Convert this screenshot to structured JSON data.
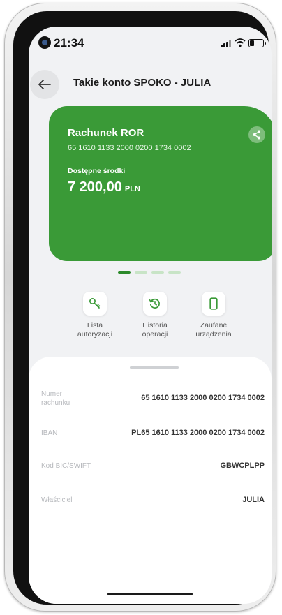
{
  "status_bar": {
    "time": "21:34"
  },
  "header": {
    "title": "Takie konto SPOKO - JULIA"
  },
  "account_card": {
    "name": "Rachunek ROR",
    "number": "65 1610 1133 2000 0200 1734 0002",
    "balance_label": "Dostępne środki",
    "balance_amount": "7 200,00",
    "currency": "PLN",
    "color": "#3a9a37"
  },
  "carousel": {
    "pages": 4,
    "active_index": 0
  },
  "actions": [
    {
      "icon": "key-icon",
      "line1": "Lista",
      "line2": "autoryzacji"
    },
    {
      "icon": "history-icon",
      "line1": "Historia",
      "line2": "operacji"
    },
    {
      "icon": "phone-icon",
      "line1": "Zaufane",
      "line2": "urządzenia"
    }
  ],
  "details": {
    "account_number_label_1": "Numer",
    "account_number_label_2": "rachunku",
    "account_number_value": "65 1610 1133 2000 0200 1734 0002",
    "iban_label": "IBAN",
    "iban_value": "PL65 1610 1133 2000 0200 1734 0002",
    "swift_label": "Kod BIC/SWIFT",
    "swift_value": "GBWCPLPP",
    "owner_label": "Właściciel",
    "owner_value": "JULIA"
  },
  "colors": {
    "accent": "#3a9a37",
    "background": "#f1f2f4"
  }
}
